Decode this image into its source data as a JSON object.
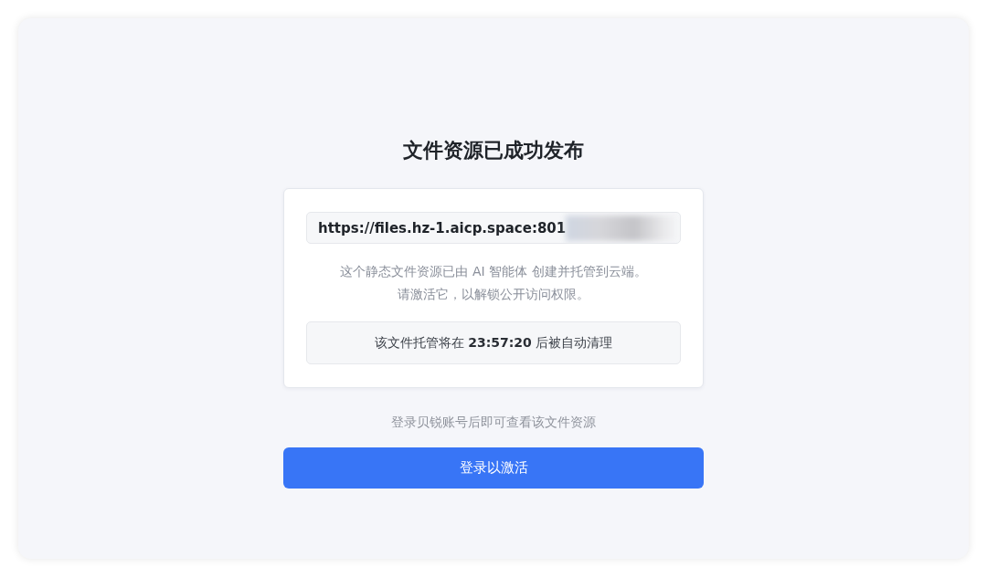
{
  "page": {
    "title": "文件资源已成功发布",
    "card": {
      "url_field": {
        "value": "https://files.hz-1.aicp.space:801",
        "redacted": true
      },
      "description": [
        "这个静态文件资源已由 AI 智能体 创建并托管到云端。",
        "请激活它，以解锁公开访问权限。"
      ],
      "notice": "该文件托管将在 **23:57:20** 后被自动清理"
    },
    "hint": "登录贝锐账号后即可查看该文件资源",
    "button": "登录以激活"
  }
}
